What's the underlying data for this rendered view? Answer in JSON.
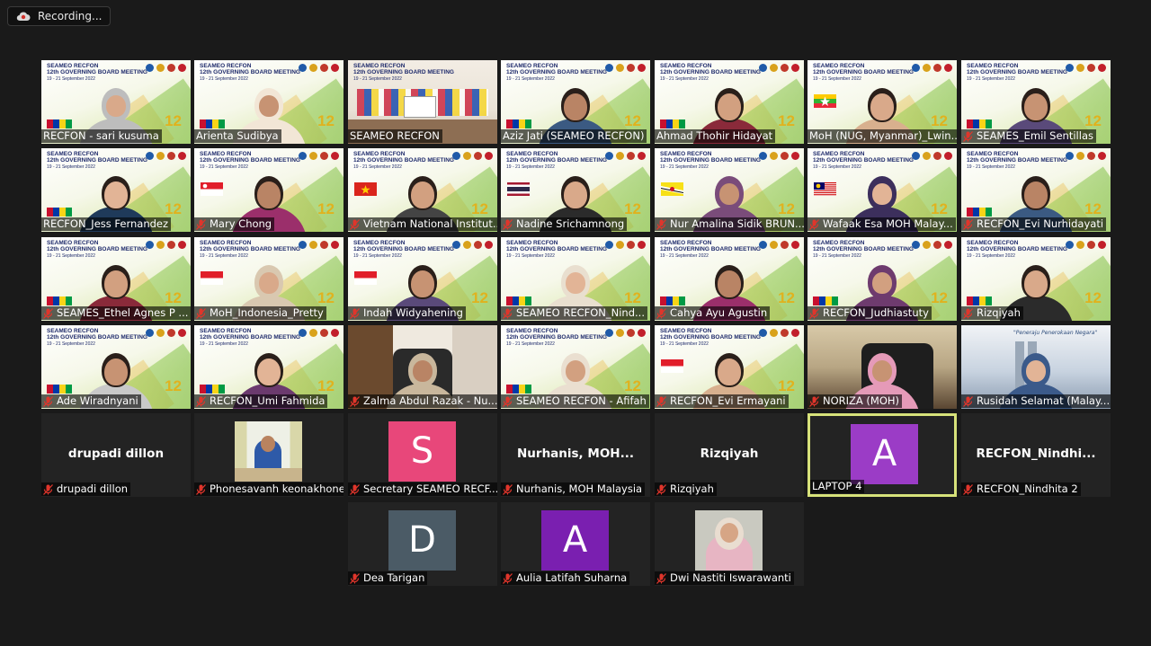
{
  "recording": {
    "label": "Recording..."
  },
  "colors": {
    "background": "#1a1a1a",
    "tile_dark": "#232323",
    "active_border": "#d7e27a",
    "avatar_pink": "#e8477a",
    "avatar_purple": "#9b3cc6",
    "avatar_slate": "#4b5b66",
    "avatar_violet": "#7a1fb0",
    "mic_muted": "#e0352b"
  },
  "banner": {
    "line1": "SEAMEO RECFON",
    "line2": "12th GOVERNING BOARD MEETING",
    "line3": "19 - 21 September 2022",
    "badge": "12"
  },
  "participants": [
    {
      "name": "RECFON - sari kusuma",
      "muted": false
    },
    {
      "name": "Arienta Sudibya",
      "muted": false
    },
    {
      "name": "SEAMEO RECFON",
      "muted": false
    },
    {
      "name": "Aziz Jati (SEAMEO RECFON)",
      "muted": false
    },
    {
      "name": "Ahmad Thohir Hidayat",
      "muted": false
    },
    {
      "name": "MoH (NUG, Myanmar)_Lwin...",
      "muted": false
    },
    {
      "name": "SEAMES_Emil Sentillas",
      "muted": true
    },
    {
      "name": "RECFON_Jess Fernandez",
      "muted": false
    },
    {
      "name": "Mary Chong",
      "muted": true
    },
    {
      "name": "Vietnam National Institut...",
      "muted": true
    },
    {
      "name": "Nadine Srichamnong",
      "muted": true
    },
    {
      "name": "Nur Amalina Sidik BRUN...",
      "muted": true
    },
    {
      "name": "Wafaak Esa MOH Malay...",
      "muted": true
    },
    {
      "name": "RECFON_Evi Nurhidayati",
      "muted": true
    },
    {
      "name": "SEAMES_Ethel Agnes P ...",
      "muted": true
    },
    {
      "name": "MoH_Indonesia_Pretty",
      "muted": true
    },
    {
      "name": "Indah Widyahening",
      "muted": true
    },
    {
      "name": "SEAMEO RECFON_Nind...",
      "muted": true
    },
    {
      "name": "Cahya Ayu Agustin",
      "muted": true
    },
    {
      "name": "RECFON_Judhiastuty",
      "muted": true
    },
    {
      "name": "Rizqiyah",
      "muted": true
    },
    {
      "name": "Ade Wiradnyani",
      "muted": true
    },
    {
      "name": "RECFON_Umi Fahmida",
      "muted": true
    },
    {
      "name": "Zalma Abdul Razak - Nu...",
      "muted": true
    },
    {
      "name": "SEAMEO RECFON - Afifah",
      "muted": true
    },
    {
      "name": "RECFON_Evi Ermayani",
      "muted": true
    },
    {
      "name": "NORIZA (MOH)",
      "muted": true
    },
    {
      "name": "Rusidah Selamat (Malay...",
      "muted": true
    },
    {
      "name": "drupadi dillon",
      "display": "drupadi dillon",
      "muted": true
    },
    {
      "name": "Phonesavanh keonakhone",
      "muted": true
    },
    {
      "name": "Secretary SEAMEO RECF...",
      "letter": "S",
      "muted": true
    },
    {
      "name": "Nurhanis, MOH Malaysia",
      "display": "Nurhanis,  MOH...",
      "muted": true
    },
    {
      "name": "Rizqiyah",
      "display": "Rizqiyah",
      "muted": true
    },
    {
      "name": "LAPTOP 4",
      "letter": "A",
      "muted": false
    },
    {
      "name": "RECFON_Nindhita 2",
      "display": "RECFON_Nindhi...",
      "muted": true
    },
    {
      "name": "Dea Tarigan",
      "letter": "D",
      "muted": true
    },
    {
      "name": "Aulia Latifah Suharna",
      "letter": "A",
      "muted": true
    },
    {
      "name": "Dwi Nastiti Iswarawanti",
      "muted": true
    }
  ],
  "rusidah_slogan": "\"Peneraju Penerokaan Negara\""
}
